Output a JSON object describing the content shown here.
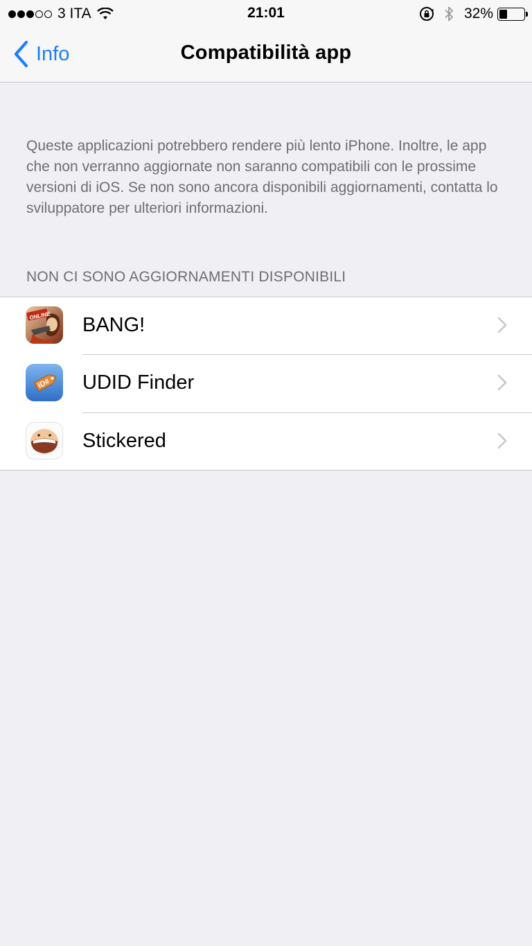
{
  "status_bar": {
    "signal_filled": 3,
    "signal_total": 5,
    "carrier": "3 ITA",
    "time": "21:01",
    "battery_percent_text": "32%",
    "battery_level": 0.32
  },
  "nav": {
    "back_label": "Info",
    "title": "Compatibilità app"
  },
  "description": "Queste applicazioni potrebbero rendere più lento iPhone. Inoltre, le app che non verranno aggiornate non saranno compatibili con le prossime versioni di iOS. Se non sono ancora disponibili aggiornamenti, contatta lo sviluppatore per ulteriori informazioni.",
  "section_header": "NON CI SONO AGGIORNAMENTI DISPONIBILI",
  "apps": [
    {
      "name": "BANG!",
      "icon": "bang-app-icon"
    },
    {
      "name": "UDID Finder",
      "icon": "udid-finder-app-icon"
    },
    {
      "name": "Stickered",
      "icon": "stickered-app-icon"
    }
  ],
  "colors": {
    "accent": "#1a7dfb",
    "background": "#efeff4",
    "secondary_text": "#6d6d72",
    "separator": "#c8c7cc"
  }
}
